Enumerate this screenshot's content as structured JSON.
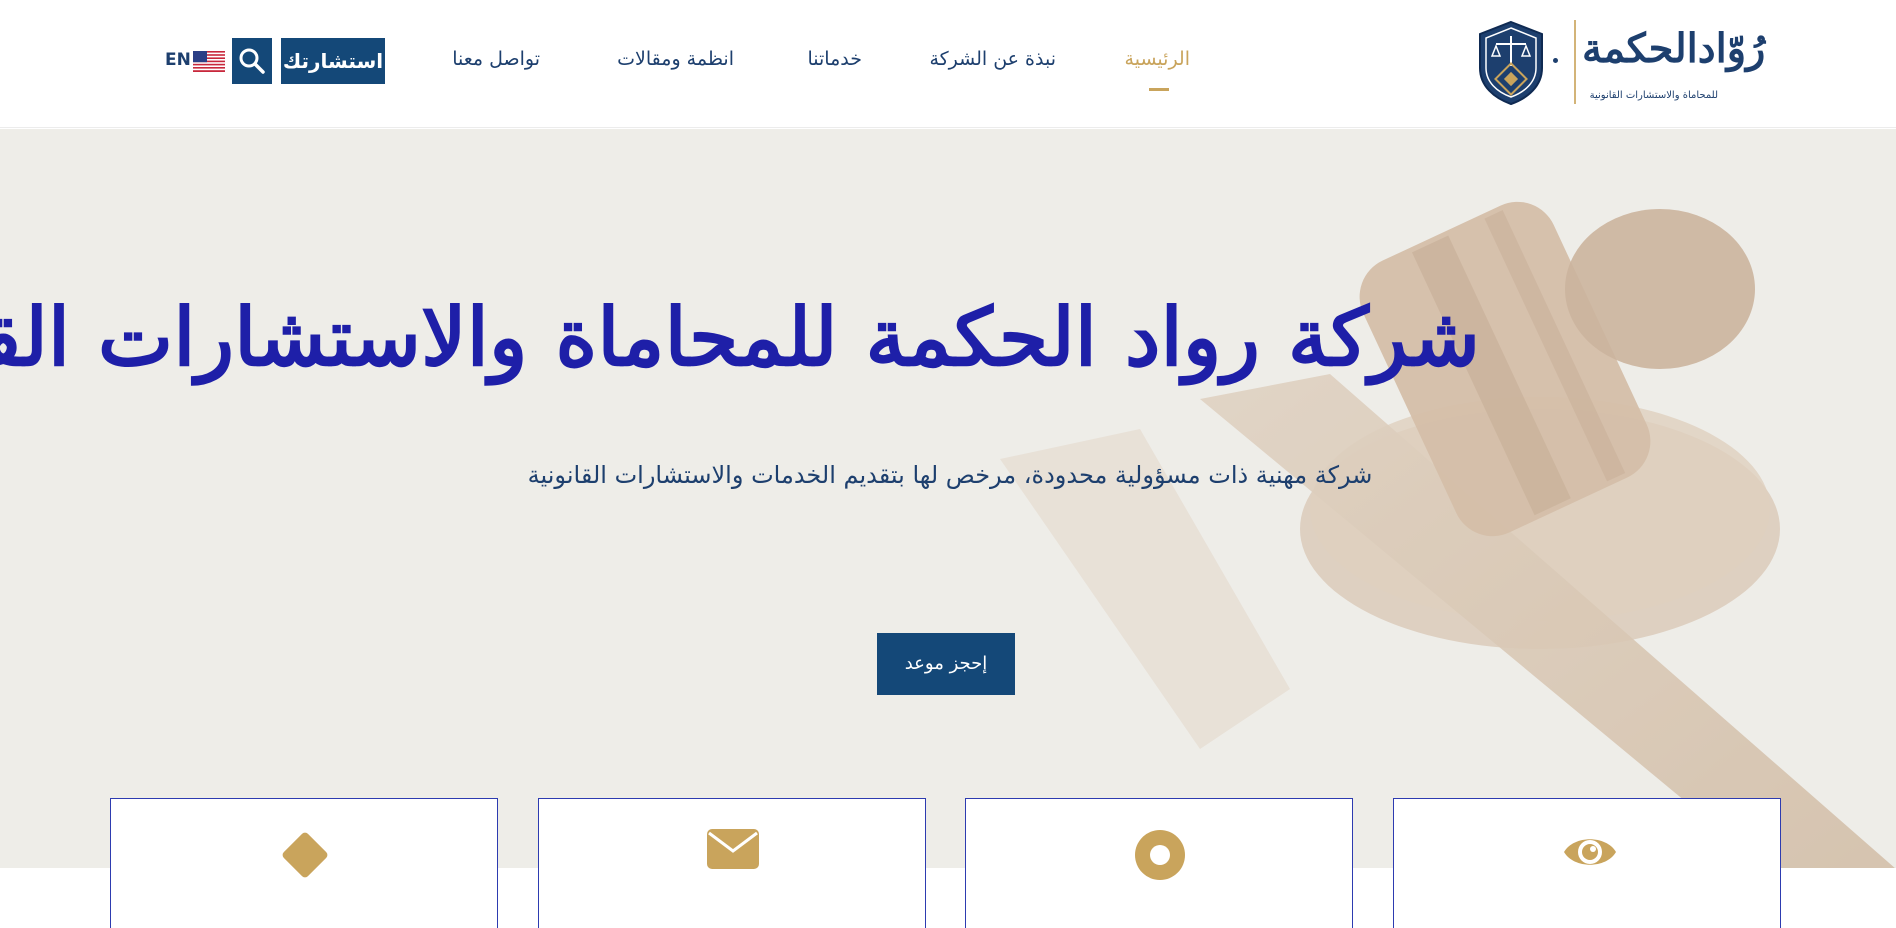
{
  "brand": {
    "name": "رُوّادالحكمة",
    "tagline": "للمحاماة والاستشارات القانونية",
    "colors": {
      "navy": "#144878",
      "gold": "#c9a45c",
      "calligraphy": "#1e1fa8"
    }
  },
  "nav": {
    "items": [
      {
        "label": "الرئيسية",
        "active": true
      },
      {
        "label": "نبذة عن الشركة",
        "active": false
      },
      {
        "label": "خدماتنا",
        "active": false
      },
      {
        "label": "انظمة ومقالات",
        "active": false
      },
      {
        "label": "تواصل معنا",
        "active": false
      }
    ]
  },
  "header_actions": {
    "consult_label": "استشارتك",
    "search_icon": "search-icon",
    "flag_icon": "us-flag-icon",
    "language_label": "EN"
  },
  "hero": {
    "title": "شركة رواد الحكمة للمحاماة والاستشارات القانونية",
    "subtitle": "شركة مهنية ذات مسؤولية محدودة، مرخص لها بتقديم الخدمات والاستشارات القانونية",
    "book_button": "إحجز موعد",
    "background_icon": "gavel-image"
  },
  "cards": [
    {
      "icon": "eye-icon"
    },
    {
      "icon": "target-icon"
    },
    {
      "icon": "envelope-icon"
    },
    {
      "icon": "diamond-icon"
    }
  ]
}
